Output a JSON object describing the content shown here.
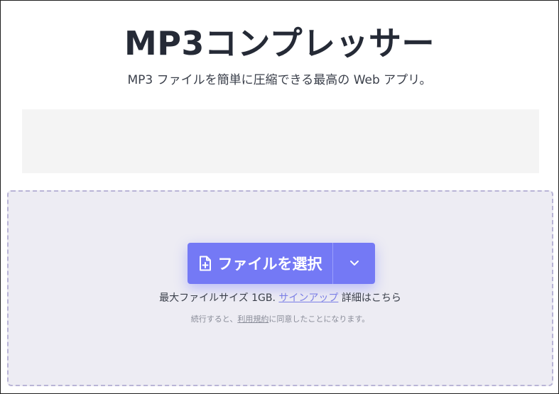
{
  "header": {
    "title": "MP3コンプレッサー",
    "subtitle": "MP3 ファイルを簡単に圧縮できる最高の Web アプリ。"
  },
  "upload": {
    "select_button_label": "ファイルを選択",
    "select_button_icon": "file-plus-icon",
    "dropdown_icon": "chevron-down-icon",
    "limit_text": "最大ファイルサイズ 1GB.",
    "signup_link": "サインアップ",
    "details_text": "詳細はこちら",
    "terms_prefix": "続行すると、",
    "terms_link": "利用規約",
    "terms_suffix": "に同意したことになります。"
  },
  "colors": {
    "accent": "#7479f5",
    "dropzone_bg": "#edecf3",
    "dropzone_border": "#b9b4d6",
    "ad_bg": "#f4f4f4"
  }
}
